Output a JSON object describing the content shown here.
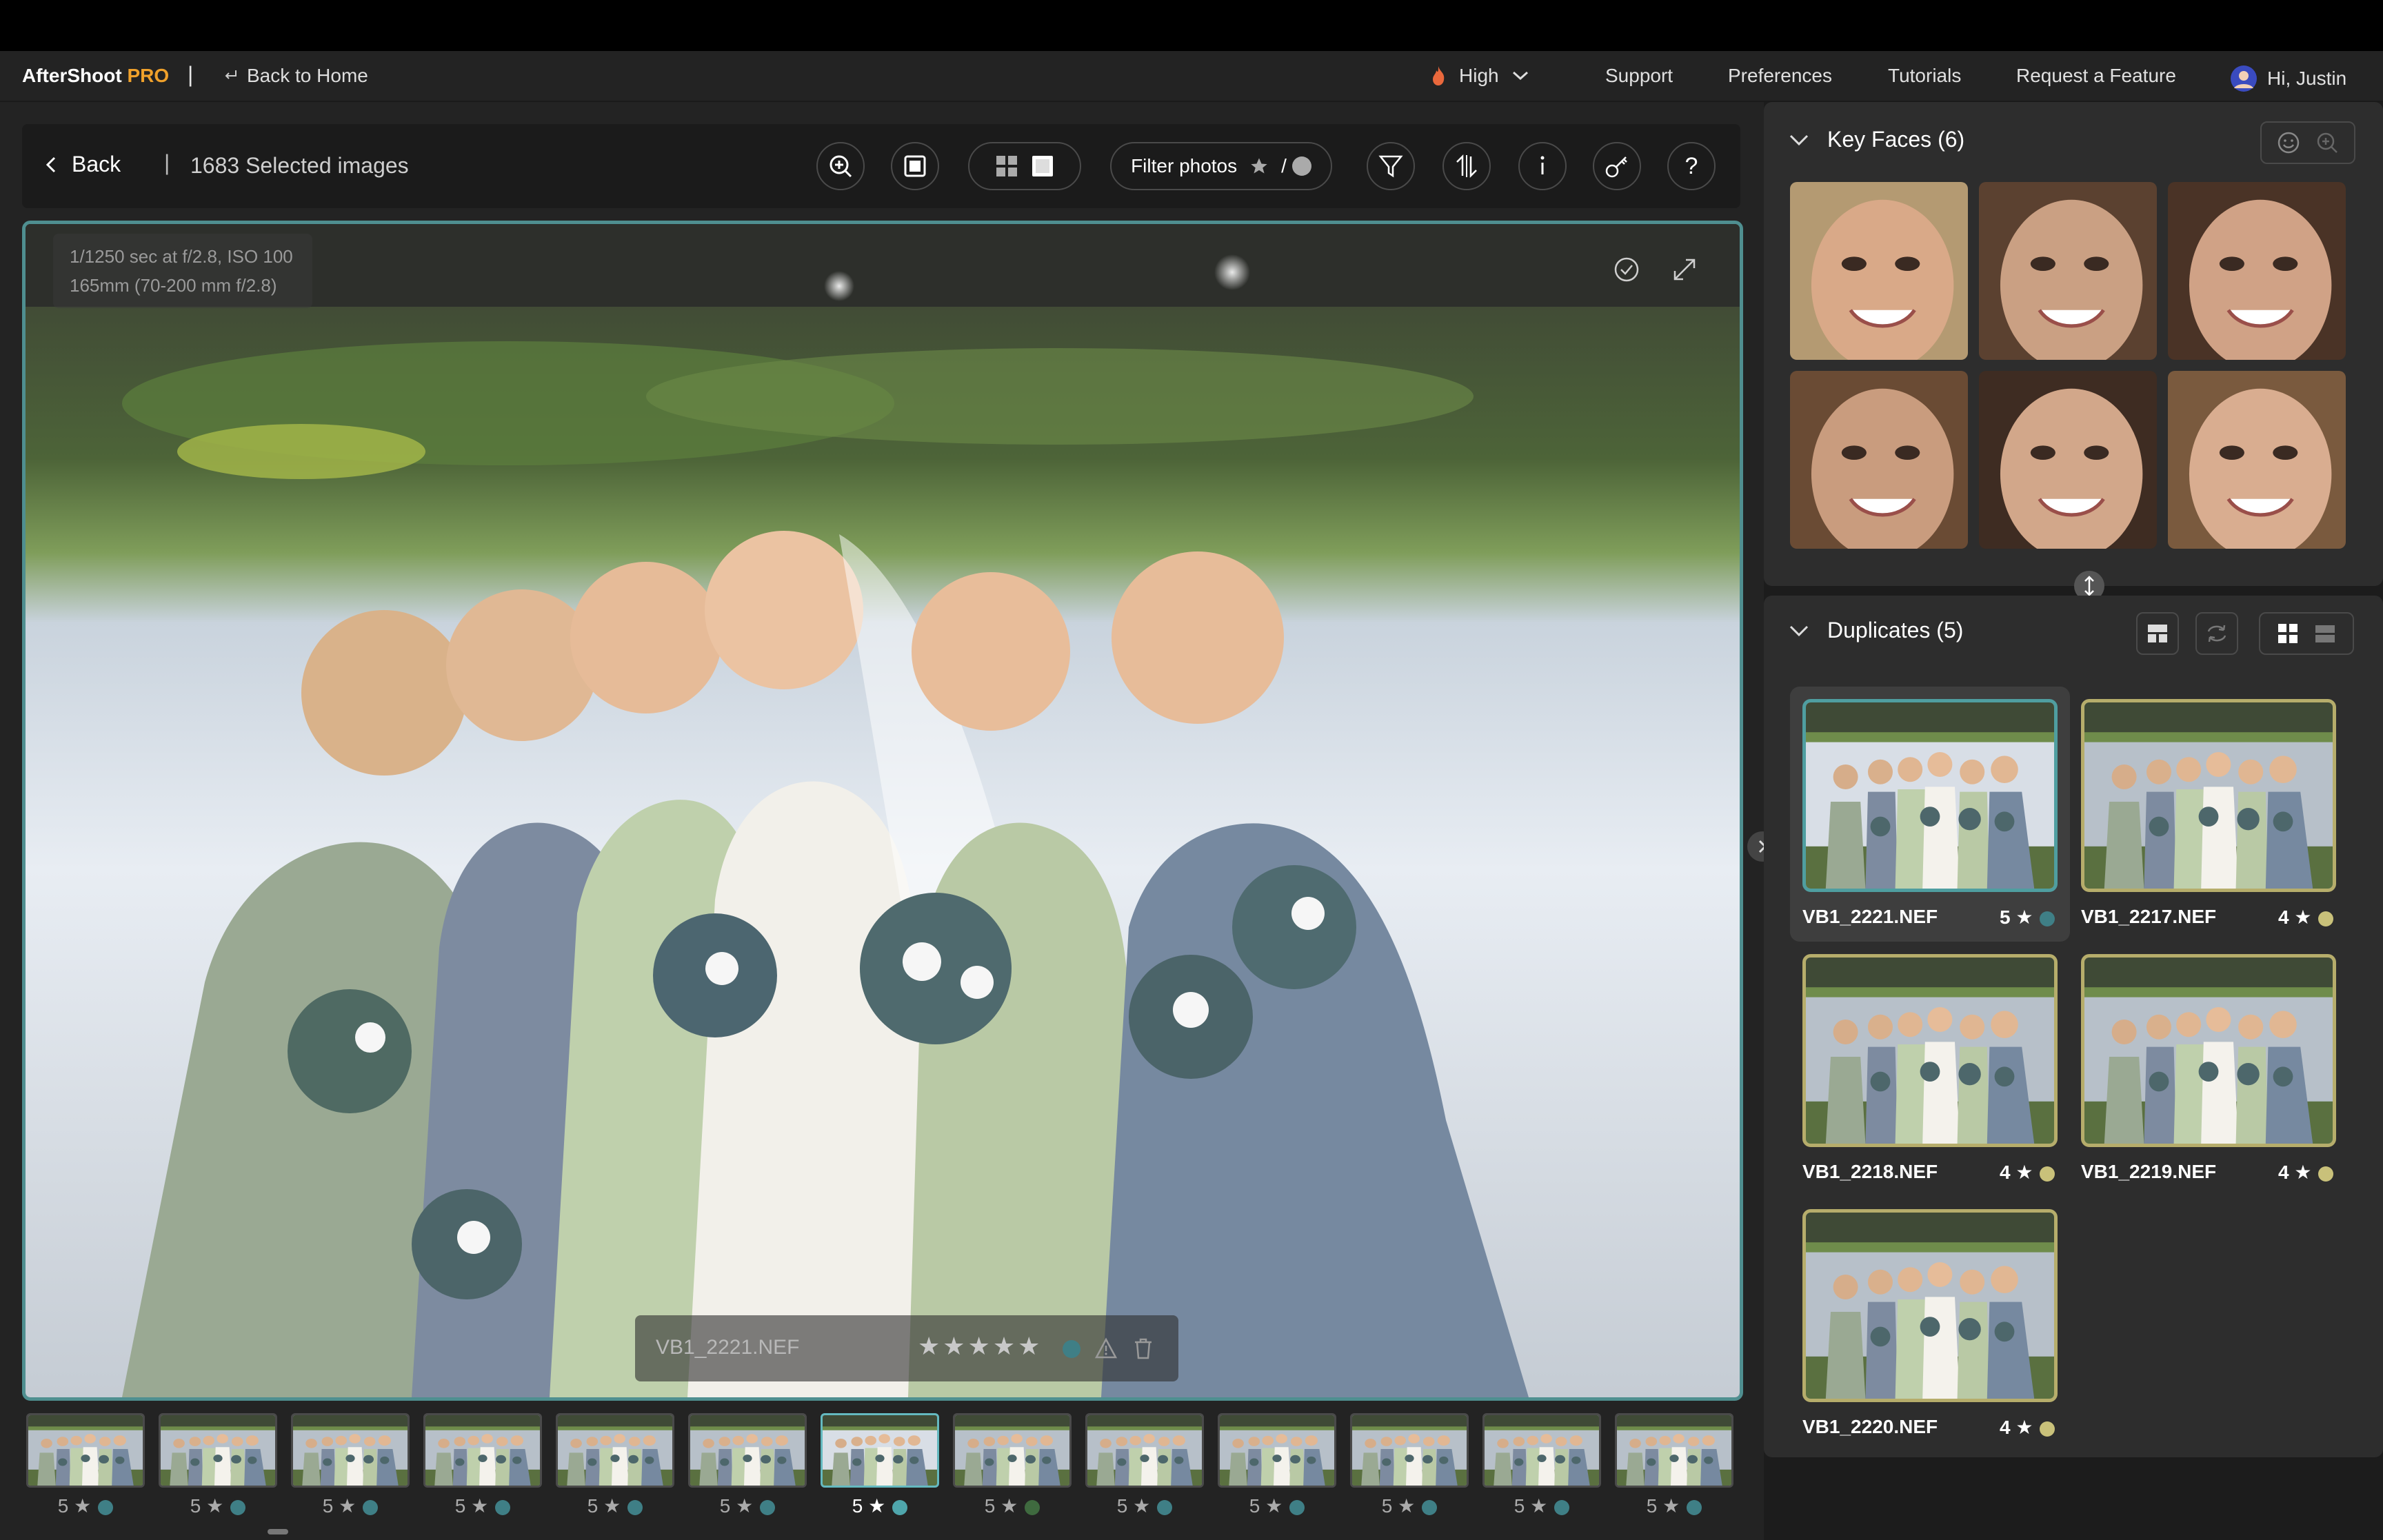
{
  "app": {
    "brand_name": "AfterShoot",
    "brand_suffix": "PRO",
    "separator": "|",
    "back_home_label": "Back to Home",
    "quality_label": "High",
    "nav": [
      "Support",
      "Preferences",
      "Tutorials",
      "Request a Feature"
    ],
    "greeting": "Hi, Justin"
  },
  "toolbar": {
    "back_label": "Back",
    "pipe": "|",
    "selected_count": "1683 Selected images",
    "filter_label": "Filter photos",
    "filter_sep": "/",
    "help_label": "?"
  },
  "viewer": {
    "exif_line1": "1/1250 sec at f/2.8, ISO 100",
    "exif_line2": "165mm (70-200 mm f/2.8)",
    "filename": "VB1_2221.NEF",
    "stars": "★★★★★",
    "rating": 5
  },
  "filmstrip": [
    {
      "rating": "5",
      "dot": "#3f7f86",
      "active": false
    },
    {
      "rating": "5",
      "dot": "#3f7f86",
      "active": false
    },
    {
      "rating": "5",
      "dot": "#3f7f86",
      "active": false
    },
    {
      "rating": "5",
      "dot": "#3f7f86",
      "active": false
    },
    {
      "rating": "5",
      "dot": "#3f7f86",
      "active": false
    },
    {
      "rating": "5",
      "dot": "#3f7f86",
      "active": false
    },
    {
      "rating": "5",
      "dot": "#4fa6ac",
      "active": true
    },
    {
      "rating": "5",
      "dot": "#3f6a3f",
      "active": false
    },
    {
      "rating": "5",
      "dot": "#3f7f86",
      "active": false
    },
    {
      "rating": "5",
      "dot": "#3f7f86",
      "active": false
    },
    {
      "rating": "5",
      "dot": "#3f7f86",
      "active": false
    },
    {
      "rating": "5",
      "dot": "#3f7f86",
      "active": false
    },
    {
      "rating": "5",
      "dot": "#3f7f86",
      "active": false
    }
  ],
  "key_faces": {
    "title": "Key Faces (6)",
    "count": 6
  },
  "duplicates": {
    "title": "Duplicates (5)",
    "items": [
      {
        "name": "VB1_2221.NEF",
        "rating": "5",
        "dot": "#3f7f86",
        "selected": true
      },
      {
        "name": "VB1_2217.NEF",
        "rating": "4",
        "dot": "#c9c17a",
        "selected": false
      },
      {
        "name": "VB1_2218.NEF",
        "rating": "4",
        "dot": "#c9c17a",
        "selected": false
      },
      {
        "name": "VB1_2219.NEF",
        "rating": "4",
        "dot": "#c9c17a",
        "selected": false
      },
      {
        "name": "VB1_2220.NEF",
        "rating": "4",
        "dot": "#c9c17a",
        "selected": false
      }
    ]
  },
  "colors": {
    "accent_teal": "#4f8f90",
    "accent_yellow": "#b6ad6b",
    "brand_orange": "#f0a12b"
  },
  "icons": {
    "star": "★"
  }
}
